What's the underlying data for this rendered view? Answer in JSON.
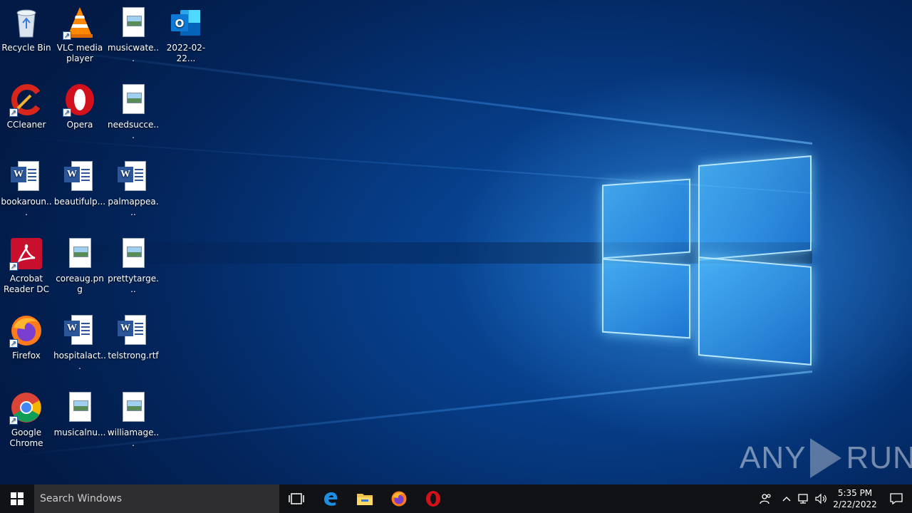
{
  "desktop": {
    "icons": [
      {
        "label": "Recycle Bin"
      },
      {
        "label": "VLC media player"
      },
      {
        "label": "musicwate..."
      },
      {
        "label": "2022-02-22..."
      },
      {
        "label": "CCleaner"
      },
      {
        "label": "Opera"
      },
      {
        "label": "needsucce..."
      },
      {
        "label": "bookaroun..."
      },
      {
        "label": "beautifulp..."
      },
      {
        "label": "palmappea..."
      },
      {
        "label": "Acrobat Reader DC"
      },
      {
        "label": "coreaug.png"
      },
      {
        "label": "prettytarge..."
      },
      {
        "label": "Firefox"
      },
      {
        "label": "hospitalact..."
      },
      {
        "label": "telstrong.rtf"
      },
      {
        "label": "Google Chrome"
      },
      {
        "label": "musicalnu..."
      },
      {
        "label": "williamage..."
      }
    ]
  },
  "watermark": {
    "left": "ANY",
    "right": "RUN"
  },
  "taskbar": {
    "search_placeholder": "Search Windows",
    "pinned": [
      "task-view-icon",
      "edge-icon",
      "file-explorer-icon",
      "firefox-icon",
      "opera-icon"
    ],
    "clock": {
      "time": "5:35 PM",
      "date": "2/22/2022"
    }
  },
  "colors": {
    "taskbar": "#101216",
    "search": "#2d2d30",
    "accent": "#0a4fa3"
  }
}
